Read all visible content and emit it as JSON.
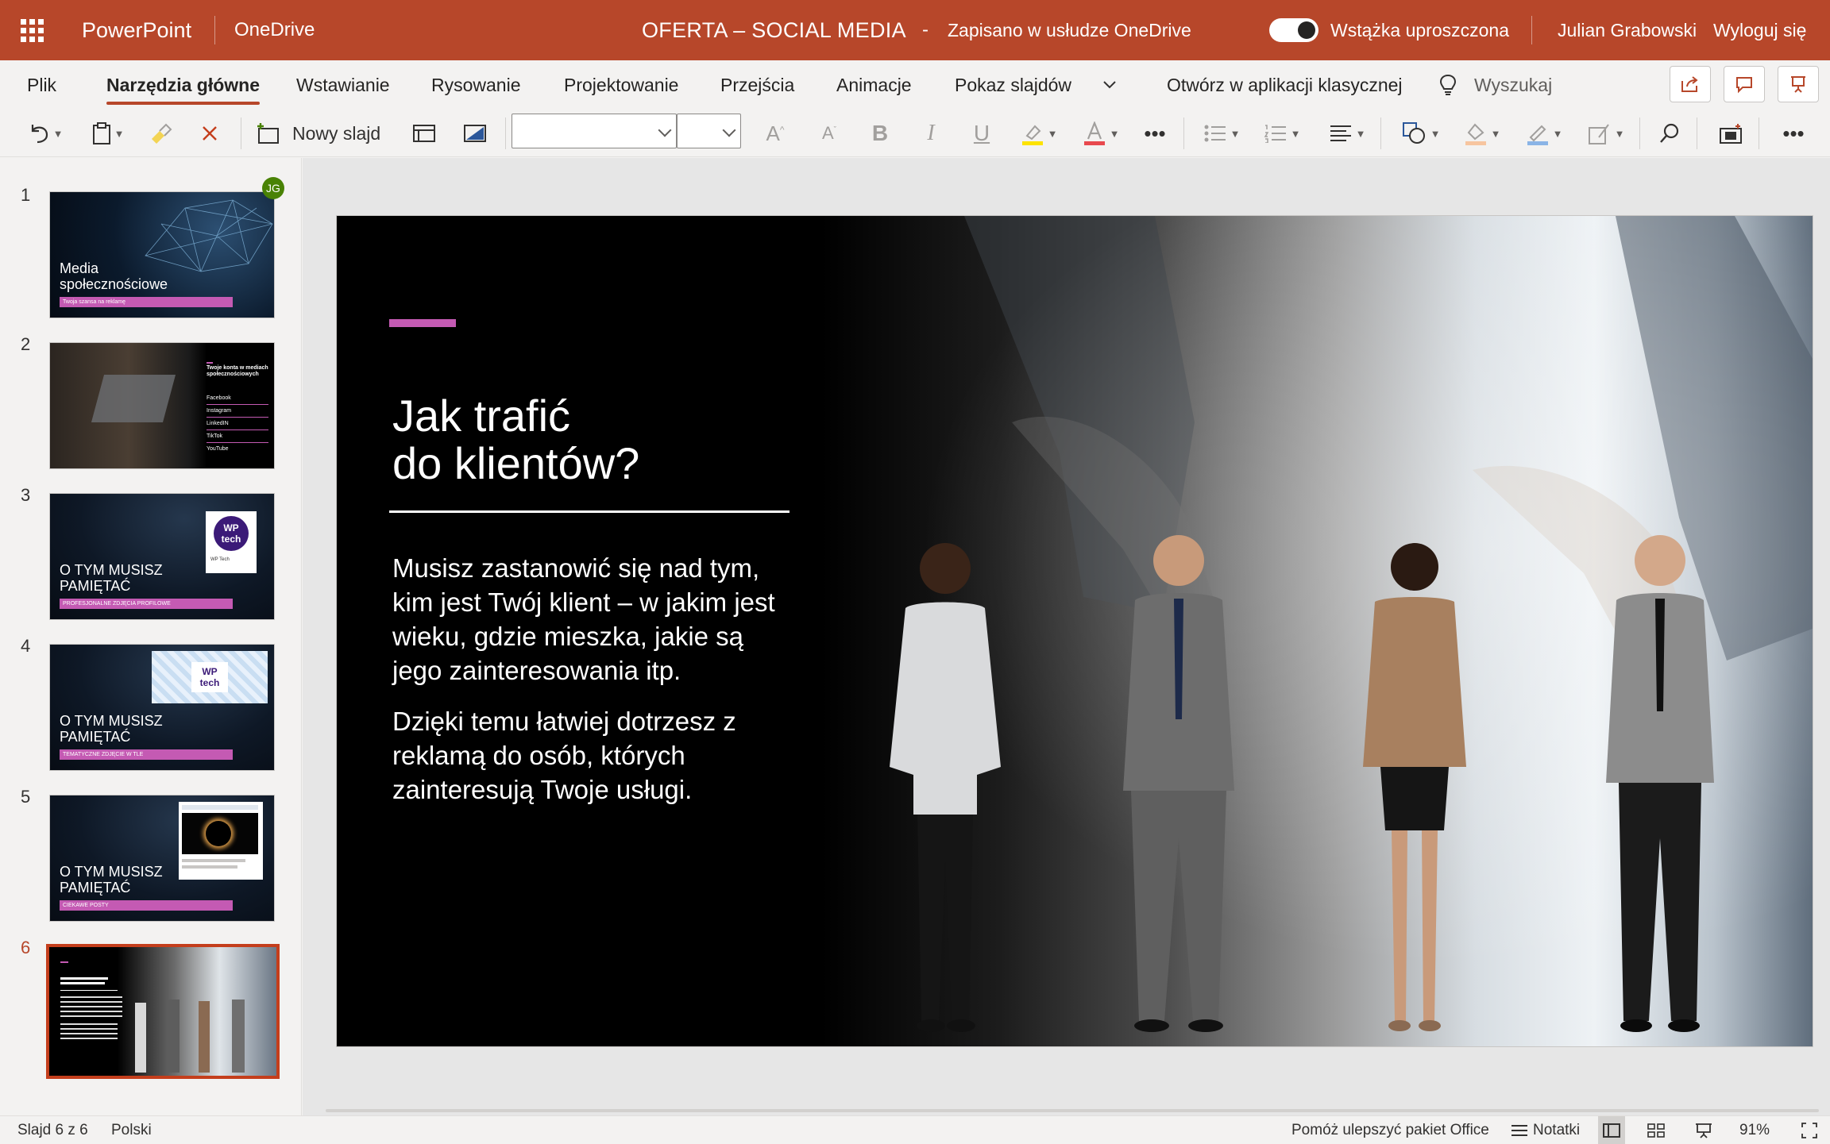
{
  "titlebar": {
    "app_name": "PowerPoint",
    "location": "OneDrive",
    "document_title": "OFERTA – SOCIAL MEDIA",
    "separator": "-",
    "save_status": "Zapisano w usłudze OneDrive",
    "simplified_ribbon_label": "Wstążka uproszczona",
    "simplified_ribbon_on": true,
    "user_name": "Julian Grabowski",
    "sign_out": "Wyloguj się"
  },
  "menu": {
    "tabs": [
      {
        "label": "Plik"
      },
      {
        "label": "Narzędzia główne",
        "active": true
      },
      {
        "label": "Wstawianie"
      },
      {
        "label": "Rysowanie"
      },
      {
        "label": "Projektowanie"
      },
      {
        "label": "Przejścia"
      },
      {
        "label": "Animacje"
      },
      {
        "label": "Pokaz slajdów"
      }
    ],
    "open_desktop": "Otwórz w aplikacji klasycznej",
    "search_label": "Wyszukaj"
  },
  "ribbon": {
    "new_slide": "Nowy slajd",
    "font_name": "",
    "font_size": "",
    "icons": [
      "undo-icon",
      "paste-icon",
      "format-painter-icon",
      "clear-icon",
      "new-slide-icon",
      "layout-icon",
      "background-icon",
      "grow-font-icon",
      "shrink-font-icon",
      "bold-icon",
      "italic-icon",
      "underline-icon",
      "highlight-icon",
      "font-color-icon",
      "more-icon",
      "bullets-icon",
      "numbering-icon",
      "align-icon",
      "shapes-icon",
      "fill-icon",
      "outline-icon",
      "arrange-icon",
      "find-icon",
      "designer-icon",
      "overflow-icon"
    ]
  },
  "thumbnails": [
    {
      "number": "1",
      "title_line1": "Media",
      "title_line2": "społecznościowe",
      "bar": "Twoja szansa na reklamę",
      "author_badge": "JG"
    },
    {
      "number": "2",
      "heading": "Twoje konta w mediach społecznościowych",
      "items": [
        "Facebook",
        "Instagram",
        "LinkedIN",
        "TikTok",
        "YouTube"
      ]
    },
    {
      "number": "3",
      "title_line1": "O TYM MUSISZ",
      "title_line2": "PAMIĘTAĆ",
      "bar": "PROFESJONALNE ZDJĘCIA PROFILOWE",
      "logo": "WP tech",
      "logo_caption": "WP Tech"
    },
    {
      "number": "4",
      "title_line1": "O TYM MUSISZ",
      "title_line2": "PAMIĘTAĆ",
      "bar": "TEMATYCZNE ZDJĘCIE W TLE",
      "logo": "WP tech"
    },
    {
      "number": "5",
      "title_line1": "O TYM MUSISZ",
      "title_line2": "PAMIĘTAĆ",
      "bar": "CIEKAWE POSTY"
    },
    {
      "number": "6",
      "selected": true
    }
  ],
  "slide": {
    "title_line1": "Jak trafić",
    "title_line2": "do klientów?",
    "para1_lines": [
      "Musisz zastanowić się nad tym,",
      "kim jest Twój klient – w jakim jest",
      "wieku, gdzie mieszka, jakie są",
      "jego zainteresowania itp."
    ],
    "para2_lines": [
      "Dzięki temu łatwiej dotrzesz z",
      "reklamą do osób, których",
      "zainteresują Twoje usługi."
    ],
    "accent_color": "#c45ab3"
  },
  "statusbar": {
    "slide_counter": "Slajd 6 z 6",
    "language": "Polski",
    "feedback": "Pomóż ulepszyć pakiet Office",
    "notes": "Notatki",
    "zoom": "91%"
  },
  "colors": {
    "brand": "#b7472a",
    "selection": "#c43e1c"
  }
}
